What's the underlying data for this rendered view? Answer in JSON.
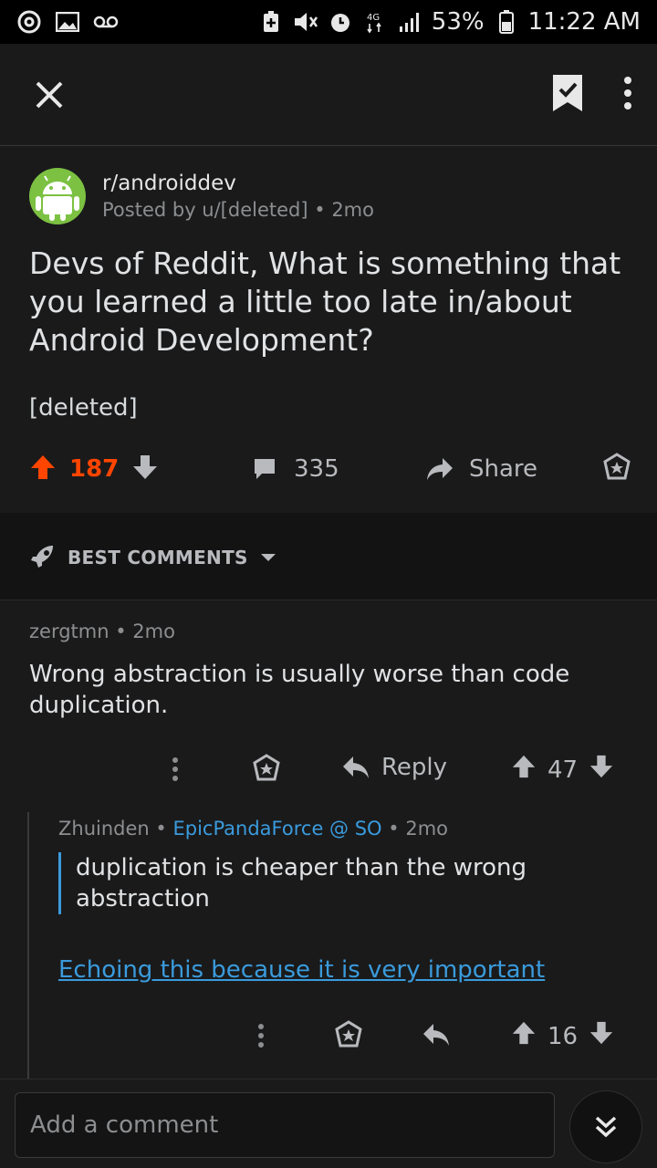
{
  "status_bar": {
    "battery": "53%",
    "time": "11:22 AM",
    "network": "4G LTE",
    "icons": [
      "at-sign-icon",
      "image-icon",
      "voicemail-icon",
      "battery-saver-icon",
      "mute-icon",
      "alarm-icon",
      "network-4g-icon",
      "signal-icon",
      "battery-icon"
    ]
  },
  "toolbar": {
    "close_icon": "close-icon",
    "save_icon": "bookmark-check-icon",
    "more_icon": "more-vertical-icon"
  },
  "post": {
    "subreddit": "r/androiddev",
    "posted_by": "Posted by u/[deleted]",
    "age": "2mo",
    "title": "Devs of Reddit, What is something that you learned a little too late in/about Android Development?",
    "body": "[deleted]",
    "score": "187",
    "comments": "335",
    "share_label": "Share",
    "colors": {
      "upvote": "#ff4500"
    }
  },
  "sort": {
    "label": "BEST COMMENTS"
  },
  "comments": [
    {
      "author": "zergtmn",
      "age": "2mo",
      "text": "Wrong abstraction is usually worse than code duplication.",
      "reply_label": "Reply",
      "score": "47"
    },
    {
      "author": "Zhuinden",
      "flair": "EpicPandaForce @ SO",
      "age": "2mo",
      "quote": "duplication is cheaper than the wrong abstraction",
      "link_text": "Echoing this because it is very important",
      "score": "16"
    }
  ],
  "composer": {
    "placeholder": "Add a comment"
  }
}
